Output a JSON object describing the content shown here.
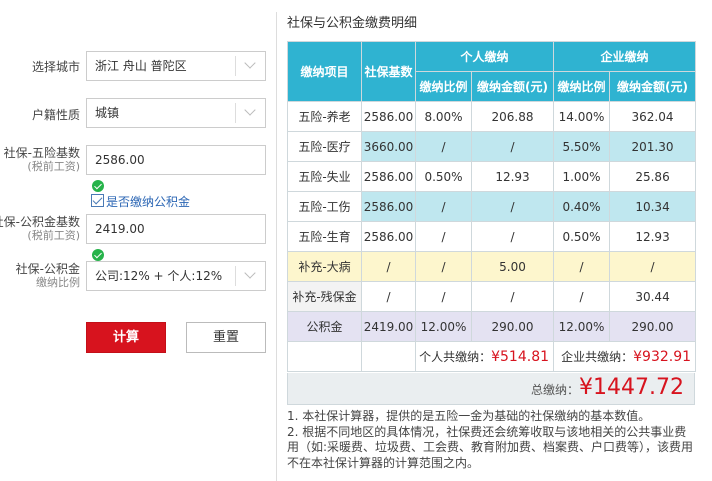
{
  "form": {
    "city_label": "选择城市",
    "city_value": "浙江 舟山 普陀区",
    "hukou_label": "户籍性质",
    "hukou_value": "城镇",
    "social_base_label": "社保-五险基数",
    "social_base_sub": "(税前工资)",
    "social_base_value": "2586.00",
    "pay_fund_label": "是否缴纳公积金",
    "fund_base_label": "社保-公积金基数",
    "fund_base_sub": "(税前工资)",
    "fund_base_value": "2419.00",
    "fund_ratio_label": "社保-公积金",
    "fund_ratio_sub": "缴纳比例",
    "fund_ratio_value": "公司:12% + 个人:12%",
    "calc_button": "计算",
    "reset_button": "重置"
  },
  "panel": {
    "title": "社保与公积金缴费明细",
    "headers": {
      "item": "缴纳项目",
      "base": "社保基数",
      "personal": "个人缴纳",
      "company": "企业缴纳",
      "ratio": "缴纳比例",
      "amount": "缴纳金额(元)"
    },
    "rows": [
      {
        "name": "五险-养老",
        "base": "2586.00",
        "p_ratio": "8.00%",
        "p_amount": "206.88",
        "c_ratio": "14.00%",
        "c_amount": "362.04"
      },
      {
        "name": "五险-医疗",
        "base": "3660.00",
        "p_ratio": "/",
        "p_amount": "/",
        "c_ratio": "5.50%",
        "c_amount": "201.30"
      },
      {
        "name": "五险-失业",
        "base": "2586.00",
        "p_ratio": "0.50%",
        "p_amount": "12.93",
        "c_ratio": "1.00%",
        "c_amount": "25.86"
      },
      {
        "name": "五险-工伤",
        "base": "2586.00",
        "p_ratio": "/",
        "p_amount": "/",
        "c_ratio": "0.40%",
        "c_amount": "10.34"
      },
      {
        "name": "五险-生育",
        "base": "2586.00",
        "p_ratio": "/",
        "p_amount": "/",
        "c_ratio": "0.50%",
        "c_amount": "12.93"
      },
      {
        "name": "补充-大病",
        "base": "/",
        "p_ratio": "/",
        "p_amount": "5.00",
        "c_ratio": "/",
        "c_amount": "/"
      },
      {
        "name": "补充-残保金",
        "base": "/",
        "p_ratio": "/",
        "p_amount": "/",
        "c_ratio": "/",
        "c_amount": "30.44"
      },
      {
        "name": "公积金",
        "base": "2419.00",
        "p_ratio": "12.00%",
        "p_amount": "290.00",
        "c_ratio": "12.00%",
        "c_amount": "290.00"
      }
    ],
    "personal_total_label": "个人共缴纳：",
    "personal_total_value": "¥514.81",
    "company_total_label": "企业共缴纳：",
    "company_total_value": "¥932.91",
    "grand_total_label": "总缴纳：",
    "grand_total_value": "¥1447.72",
    "notes": [
      "1. 本社保计算器，提供的是五险一金为基础的社保缴纳的基本数值。",
      "2. 根据不同地区的具体情况，社保费还会统筹收取与该地相关的公共事业费用（如:采暖费、垃圾费、工会费、教育附加费、档案费、户口费等），该费用不在本社保计算器的计算范围之内。"
    ]
  },
  "colors": {
    "header": "#2fb3d1",
    "accent_red": "#d7131e",
    "row_blue": "#c4e9f2",
    "row_yellow": "#fcf3c4",
    "row_lavender": "#d6d3ea"
  }
}
